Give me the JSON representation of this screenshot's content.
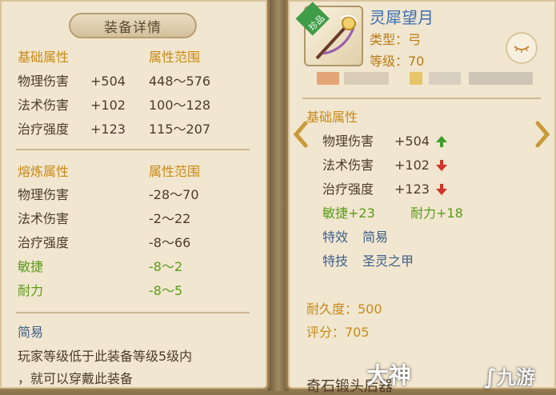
{
  "left": {
    "title": "装备详情",
    "base": {
      "header": "基础属性",
      "range_header": "属性范围",
      "rows": [
        {
          "name": "物理伤害",
          "value": "+504",
          "range": "448～576"
        },
        {
          "name": "法术伤害",
          "value": "+102",
          "range": "100～128"
        },
        {
          "name": "治疗强度",
          "value": "+123",
          "range": "115～207"
        }
      ]
    },
    "refine": {
      "header": "熔炼属性",
      "range_header": "属性范围",
      "rows": [
        {
          "name": "物理伤害",
          "range": "-28～70"
        },
        {
          "name": "法术伤害",
          "range": "-2～22"
        },
        {
          "name": "治疗强度",
          "range": "-8～66"
        },
        {
          "name": "敏捷",
          "range": "-8～2"
        },
        {
          "name": "耐力",
          "range": "-8～5"
        }
      ]
    },
    "effect": {
      "name": "简易",
      "desc_line1": "玩家等级低于此装备等级5级内",
      "desc_line2": "，就可以穿戴此装备"
    }
  },
  "right": {
    "badge": "珍品",
    "item_name": "灵犀望月",
    "type_line": "类型：弓",
    "level_line": "等级：70",
    "base_header": "基础属性",
    "stats": [
      {
        "name": "物理伤害",
        "value": "+504",
        "trend": "up"
      },
      {
        "name": "法术伤害",
        "value": "+102",
        "trend": "down"
      },
      {
        "name": "治疗强度",
        "value": "+123",
        "trend": "down"
      }
    ],
    "agility": "敏捷+23",
    "stamina": "耐力+18",
    "effect_label": "特效",
    "effect_value": "简易",
    "skill_label": "特技",
    "skill_value": "圣灵之甲",
    "durability": "耐久度：500",
    "score": "评分：705",
    "bottom_cut": "奇石锻头后器"
  },
  "watermark": {
    "left": "大神",
    "right": "九游"
  },
  "colors": {
    "header": "#c78a18",
    "text": "#4d3c28",
    "green": "#5a9b1a",
    "blue": "#3c5f8a",
    "up": "#3f9c2e",
    "down": "#d2332a"
  }
}
